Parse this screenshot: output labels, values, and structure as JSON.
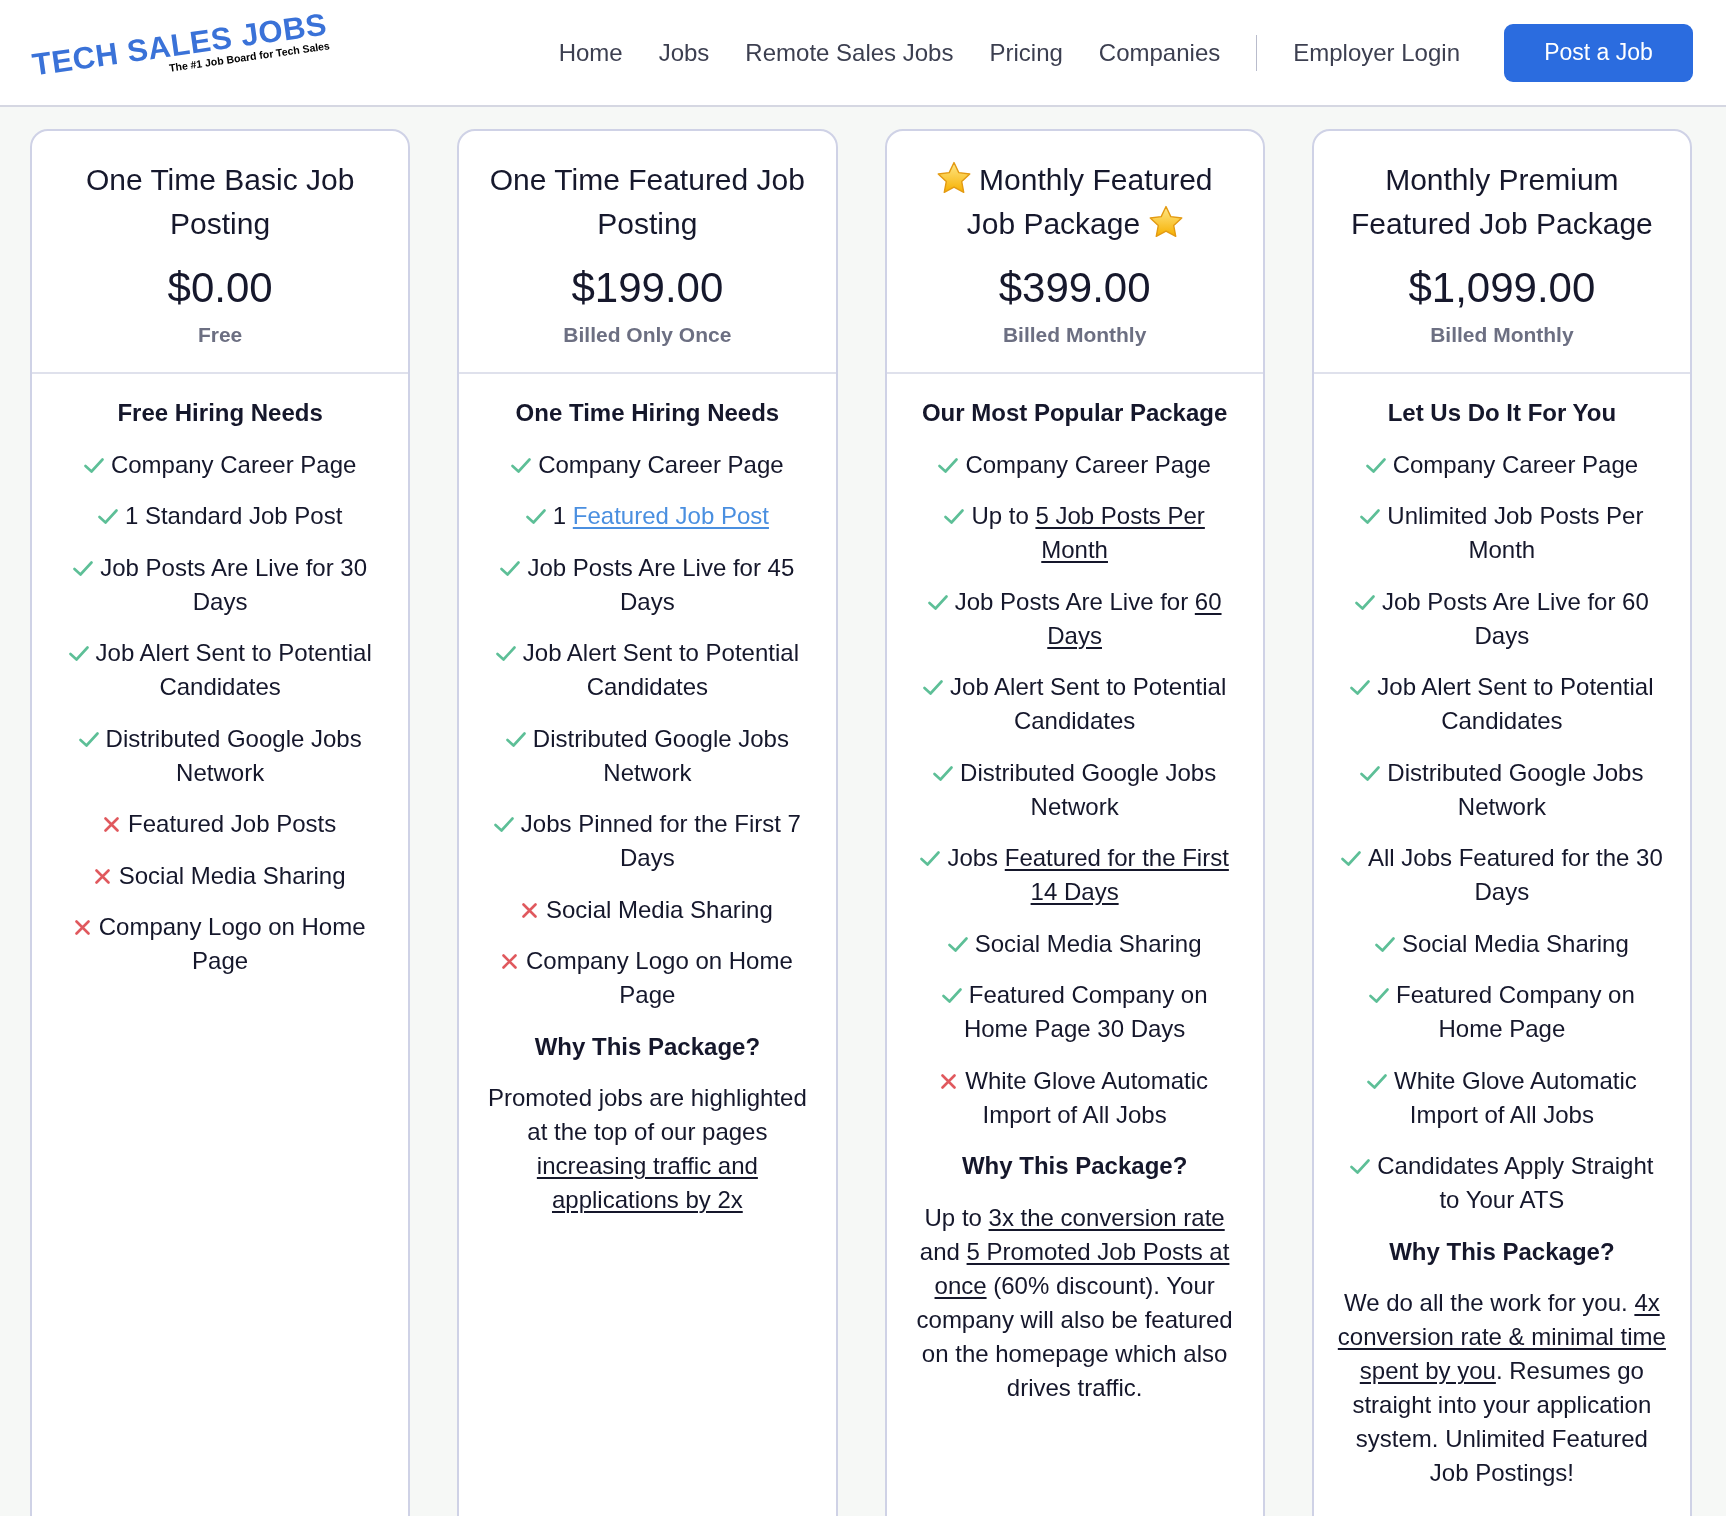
{
  "header": {
    "logo": {
      "title": "TECH SALES JOBS",
      "tagline": "The #1 Job Board for Tech Sales"
    },
    "nav": [
      "Home",
      "Jobs",
      "Remote Sales Jobs",
      "Pricing",
      "Companies"
    ],
    "secondary_nav": [
      "Employer Login"
    ],
    "cta": "Post a Job"
  },
  "cards": [
    {
      "title": "One Time Basic Job Posting",
      "starred": false,
      "price": "$0.00",
      "billing": "Free",
      "heading": "Free Hiring Needs",
      "features": [
        {
          "included": true,
          "text": "Company Career Page"
        },
        {
          "included": true,
          "text": "1 Standard Job Post"
        },
        {
          "included": true,
          "text": "Job Posts Are Live for 30 Days"
        },
        {
          "included": true,
          "text": "Job Alert Sent to Potential Candidates"
        },
        {
          "included": true,
          "text": "Distributed Google Jobs Network"
        },
        {
          "included": false,
          "text": "Featured Job Posts"
        },
        {
          "included": false,
          "text": "Social Media Sharing"
        },
        {
          "included": false,
          "text": "Company Logo on Home Page"
        }
      ]
    },
    {
      "title": "One Time Featured Job Posting",
      "starred": false,
      "price": "$199.00",
      "billing": "Billed Only Once",
      "heading": "One Time Hiring Needs",
      "features": [
        {
          "included": true,
          "text": "Company Career Page"
        },
        {
          "included": true,
          "parts": [
            {
              "kind": "text",
              "text": "1 "
            },
            {
              "kind": "accent",
              "text": "Featured Job Post"
            }
          ]
        },
        {
          "included": true,
          "text": "Job Posts Are Live for 45 Days"
        },
        {
          "included": true,
          "text": "Job Alert Sent to Potential Candidates"
        },
        {
          "included": true,
          "text": "Distributed Google Jobs Network"
        },
        {
          "included": true,
          "text": "Jobs Pinned for the First 7 Days"
        },
        {
          "included": false,
          "text": "Social Media Sharing"
        },
        {
          "included": false,
          "text": "Company Logo on Home Page"
        }
      ],
      "why": {
        "heading": "Why This Package?",
        "parts": [
          {
            "kind": "text",
            "text": "Promoted jobs are highlighted at the top of our pages "
          },
          {
            "kind": "link",
            "text": "increasing traffic and"
          },
          {
            "kind": "link",
            "text": "applications by 2x"
          }
        ]
      }
    },
    {
      "title": "Monthly Featured Job Package",
      "starred": true,
      "price": "$399.00",
      "billing": "Billed Monthly",
      "heading": "Our Most Popular Package",
      "features": [
        {
          "included": true,
          "text": "Company Career Page"
        },
        {
          "included": true,
          "parts": [
            {
              "kind": "text",
              "text": "Up to "
            },
            {
              "kind": "link",
              "text": "5 Job Posts Per"
            },
            {
              "kind": "link",
              "text": "Month"
            }
          ]
        },
        {
          "included": true,
          "parts": [
            {
              "kind": "text",
              "text": "Job Posts Are Live for "
            },
            {
              "kind": "link",
              "text": "60"
            },
            {
              "kind": "link",
              "text": "Days"
            }
          ]
        },
        {
          "included": true,
          "text": "Job Alert Sent to Potential Candidates"
        },
        {
          "included": true,
          "text": "Distributed Google Jobs Network"
        },
        {
          "included": true,
          "parts": [
            {
              "kind": "text",
              "text": "Jobs "
            },
            {
              "kind": "link",
              "text": "Featured for the First"
            },
            {
              "kind": "link",
              "text": "14 Days"
            }
          ]
        },
        {
          "included": true,
          "text": "Social Media Sharing"
        },
        {
          "included": true,
          "text": "Featured Company on Home Page 30 Days"
        },
        {
          "included": false,
          "text": "White Glove Automatic Import of All Jobs"
        }
      ],
      "why": {
        "heading": "Why This Package?",
        "parts": [
          {
            "kind": "text",
            "text": "Up to "
          },
          {
            "kind": "link",
            "text": "3x the conversion rate"
          },
          {
            "kind": "text",
            "text": " and "
          },
          {
            "kind": "link",
            "text": "5 Promoted Job Posts at"
          },
          {
            "kind": "link",
            "text": "once"
          },
          {
            "kind": "text",
            "text": " (60% discount). Your company will also be featured on the homepage which also drives traffic."
          }
        ]
      }
    },
    {
      "title": "Monthly Premium Featured Job Package",
      "starred": false,
      "price": "$1,099.00",
      "billing": "Billed Monthly",
      "heading": "Let Us Do It For You",
      "features": [
        {
          "included": true,
          "text": "Company Career Page"
        },
        {
          "included": true,
          "text": "Unlimited Job Posts Per Month"
        },
        {
          "included": true,
          "text": "Job Posts Are Live for 60 Days"
        },
        {
          "included": true,
          "text": "Job Alert Sent to Potential Candidates"
        },
        {
          "included": true,
          "text": "Distributed Google Jobs Network"
        },
        {
          "included": true,
          "text": "All Jobs Featured for the 30 Days"
        },
        {
          "included": true,
          "text": "Social Media Sharing"
        },
        {
          "included": true,
          "text": "Featured Company on Home Page"
        },
        {
          "included": true,
          "text": "White Glove Automatic Import of All Jobs"
        },
        {
          "included": true,
          "text": "Candidates Apply Straight to Your ATS"
        }
      ],
      "why": {
        "heading": "Why This Package?",
        "parts": [
          {
            "kind": "text",
            "text": "We do all the work for you. "
          },
          {
            "kind": "link",
            "text": "4x"
          },
          {
            "kind": "link",
            "text": "conversion rate & minimal time"
          },
          {
            "kind": "link",
            "text": "spent by you"
          },
          {
            "kind": "text",
            "text": ". Resumes go straight into your application system. Unlimited Featured Job Postings!"
          }
        ]
      }
    }
  ]
}
